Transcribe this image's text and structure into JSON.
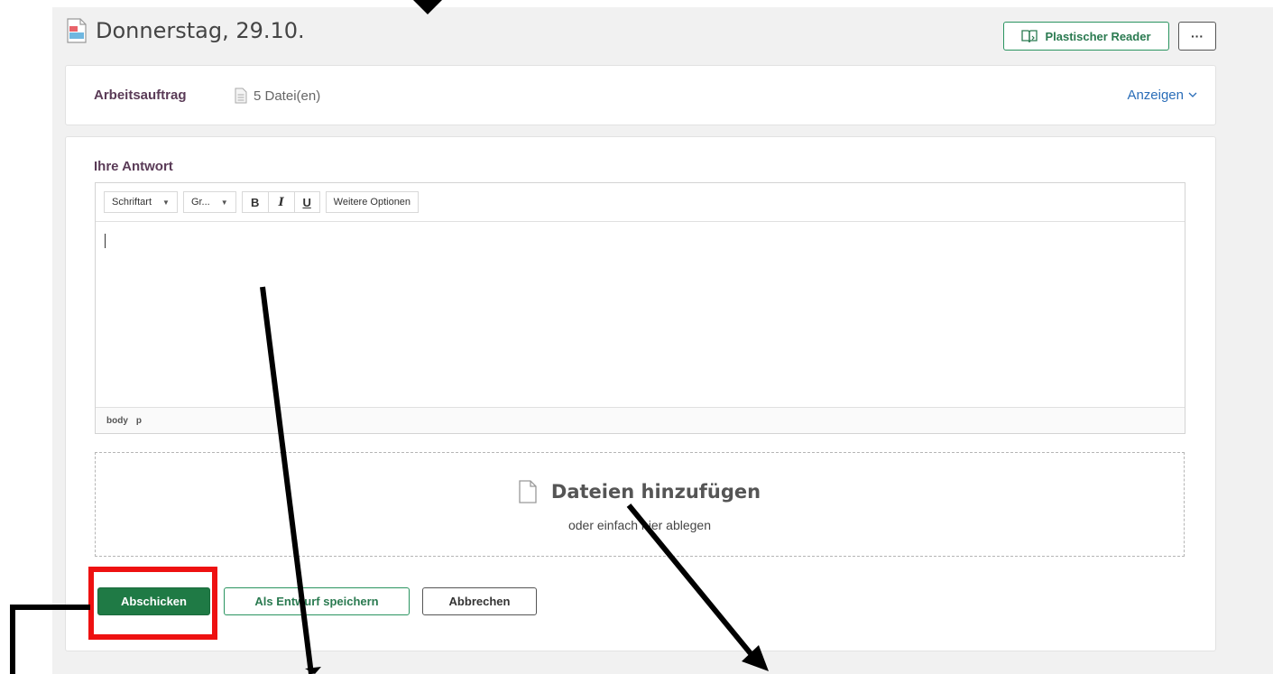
{
  "header": {
    "title": "Donnerstag, 29.10.",
    "reader_button": "Plastischer Reader",
    "more_button": "···"
  },
  "task": {
    "label": "Arbeitsauftrag",
    "files": "5 Datei(en)",
    "show_link": "Anzeigen"
  },
  "answer": {
    "label": "Ihre Antwort",
    "toolbar": {
      "font_select": "Schriftart",
      "size_select": "Gr...",
      "bold": "B",
      "italic": "I",
      "underline": "U",
      "more_options": "Weitere Optionen"
    },
    "statusbar": [
      "body",
      "p"
    ]
  },
  "dropzone": {
    "title": "Dateien hinzufügen",
    "subtitle": "oder einfach hier ablegen"
  },
  "actions": {
    "submit": "Abschicken",
    "save_draft": "Als Entwurf speichern",
    "cancel": "Abbrechen"
  },
  "colors": {
    "accent_green": "#1f7a45",
    "heading_purple": "#5a3b57",
    "link_blue": "#2a6db8",
    "highlight_red": "#ee1111"
  }
}
